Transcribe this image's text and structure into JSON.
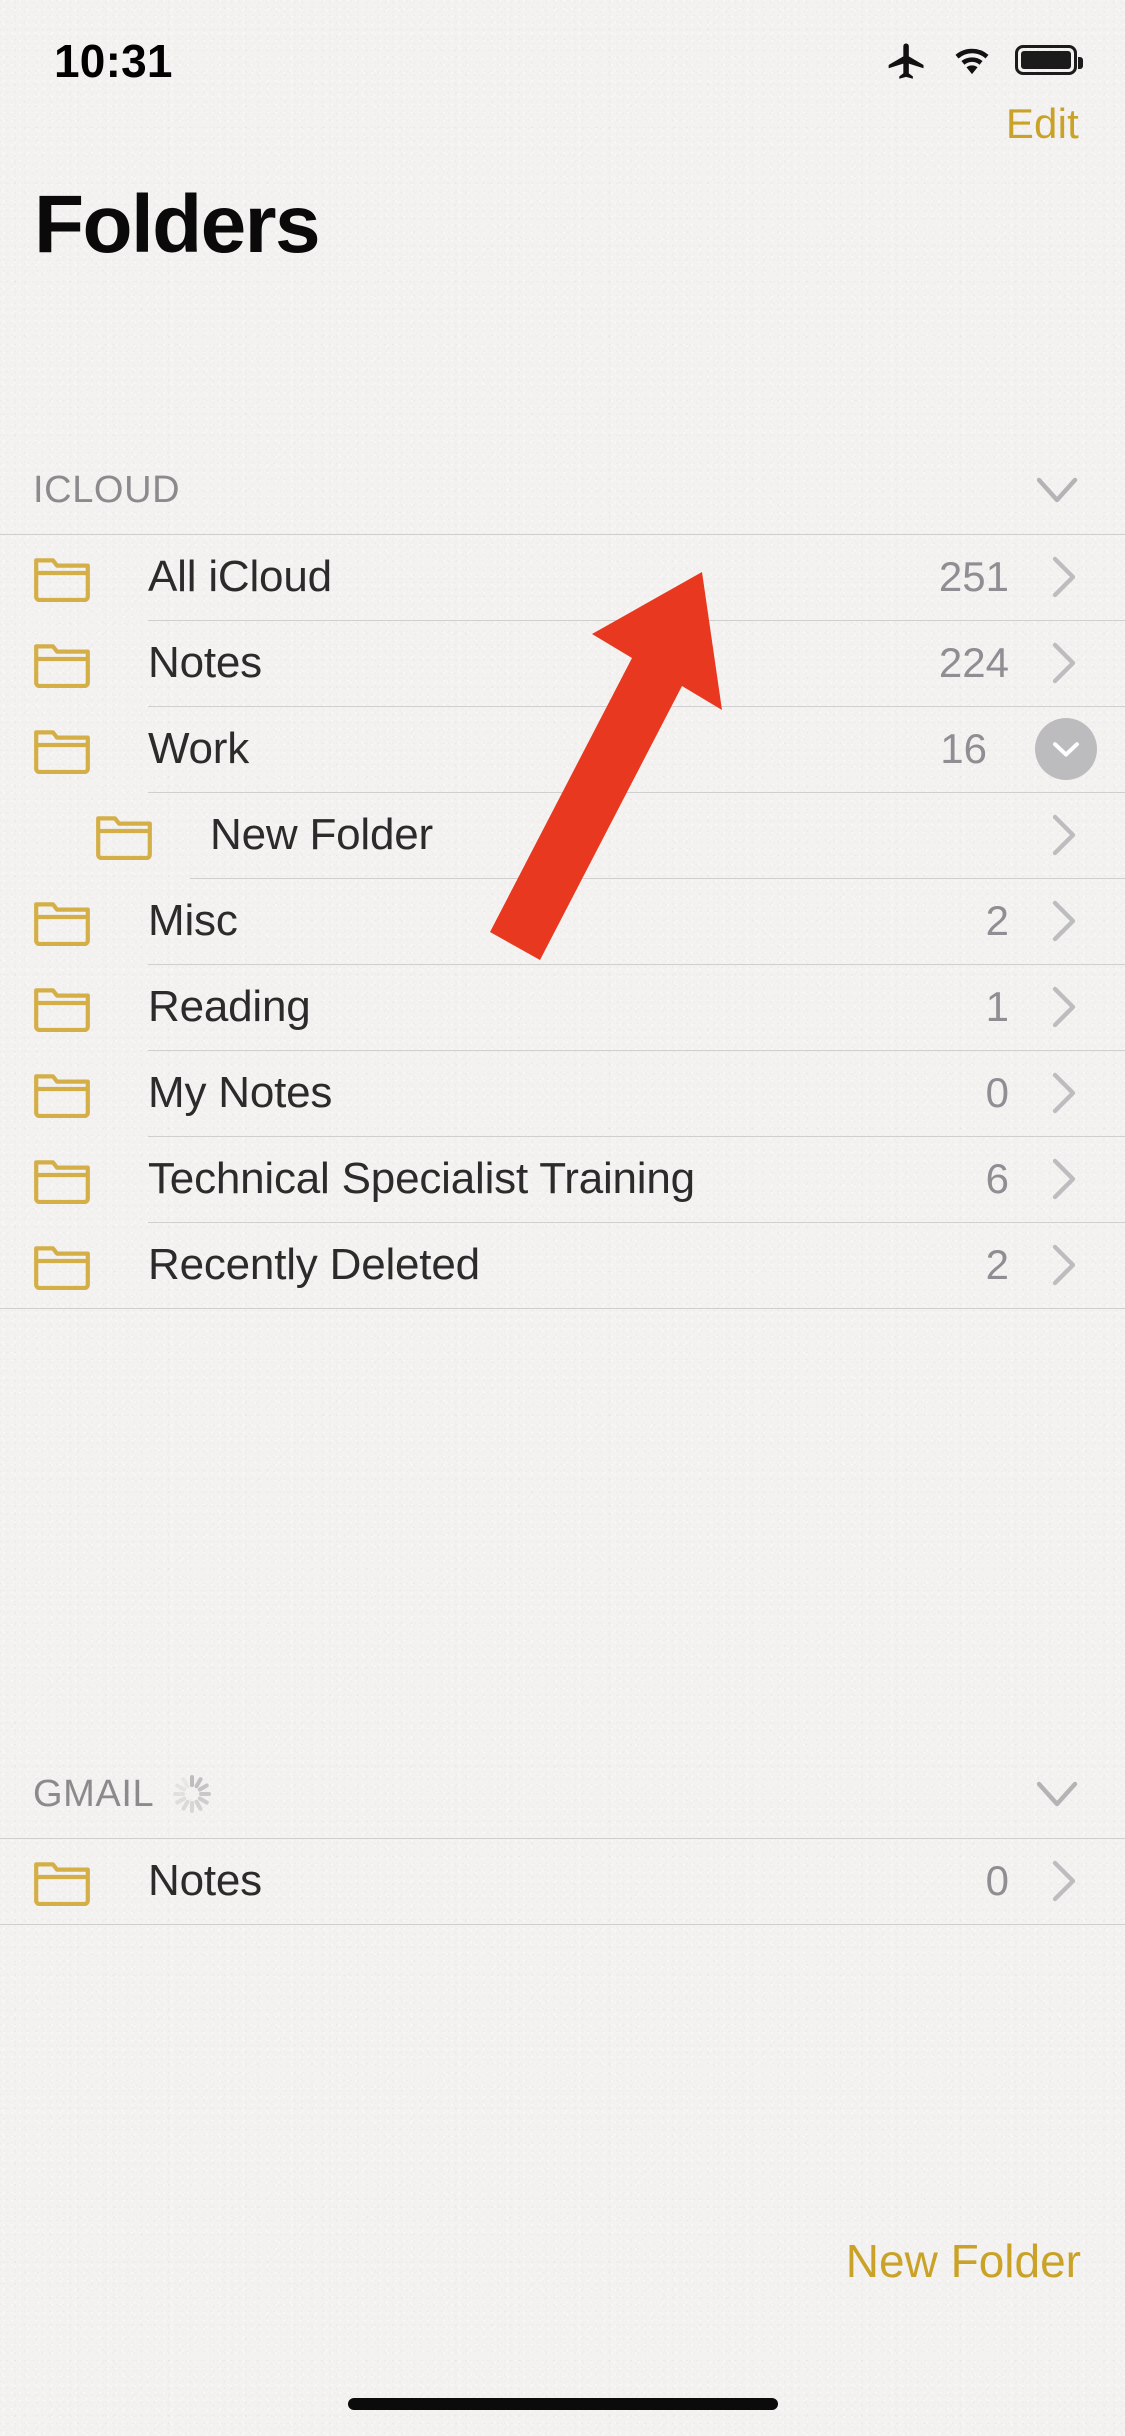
{
  "status_bar": {
    "time": "10:31",
    "icons": [
      "airplane-mode-icon",
      "wifi-icon",
      "battery-icon"
    ]
  },
  "nav": {
    "edit_label": "Edit",
    "title": "Folders"
  },
  "colors": {
    "accent_gold": "#c9a227",
    "folder_gold": "#d4af48",
    "annotation_red": "#e8381f",
    "secondary_text": "#8e8e93",
    "background": "#f3f2f0"
  },
  "sections": [
    {
      "name": "icloud",
      "title": "ICLOUD",
      "collapsed": false,
      "chevron": "chevron-down-icon",
      "spinner": false,
      "rows": [
        {
          "label": "All iCloud",
          "count": "251",
          "indent": false,
          "accessory": "chevron-right-icon"
        },
        {
          "label": "Notes",
          "count": "224",
          "indent": false,
          "accessory": "chevron-right-icon"
        },
        {
          "label": "Work",
          "count": "16",
          "indent": false,
          "accessory": "expand-circle-chevron-down-icon"
        },
        {
          "label": "New Folder",
          "count": "",
          "indent": true,
          "accessory": "chevron-right-icon"
        },
        {
          "label": "Misc",
          "count": "2",
          "indent": false,
          "accessory": "chevron-right-icon"
        },
        {
          "label": "Reading",
          "count": "1",
          "indent": false,
          "accessory": "chevron-right-icon"
        },
        {
          "label": "My Notes",
          "count": "0",
          "indent": false,
          "accessory": "chevron-right-icon"
        },
        {
          "label": "Technical Specialist Training",
          "count": "6",
          "indent": false,
          "accessory": "chevron-right-icon"
        },
        {
          "label": "Recently Deleted",
          "count": "2",
          "indent": false,
          "accessory": "chevron-right-icon"
        }
      ]
    },
    {
      "name": "gmail",
      "title": "GMAIL",
      "collapsed": false,
      "chevron": "chevron-down-icon",
      "spinner": true,
      "rows": [
        {
          "label": "Notes",
          "count": "0",
          "indent": false,
          "accessory": "chevron-right-icon"
        }
      ]
    }
  ],
  "annotation": {
    "type": "arrow",
    "points_to": "work-row-expand-button",
    "color": "#e8381f"
  },
  "bottom_bar": {
    "new_folder_label": "New Folder"
  }
}
